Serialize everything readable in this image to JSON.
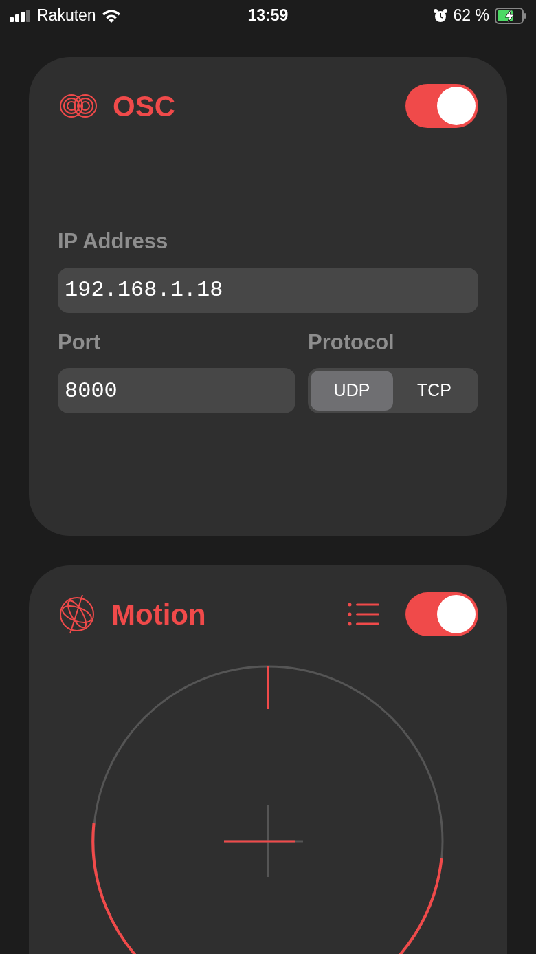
{
  "status_bar": {
    "carrier": "Rakuten",
    "time": "13:59",
    "battery": "62 %",
    "charging": true
  },
  "osc": {
    "title": "OSC",
    "enabled": true,
    "ip_label": "IP Address",
    "ip_value": "192.168.1.18",
    "port_label": "Port",
    "port_value": "8000",
    "protocol_label": "Protocol",
    "protocols": [
      {
        "label": "UDP",
        "selected": true
      },
      {
        "label": "TCP",
        "selected": false
      }
    ]
  },
  "motion": {
    "title": "Motion",
    "enabled": true
  }
}
